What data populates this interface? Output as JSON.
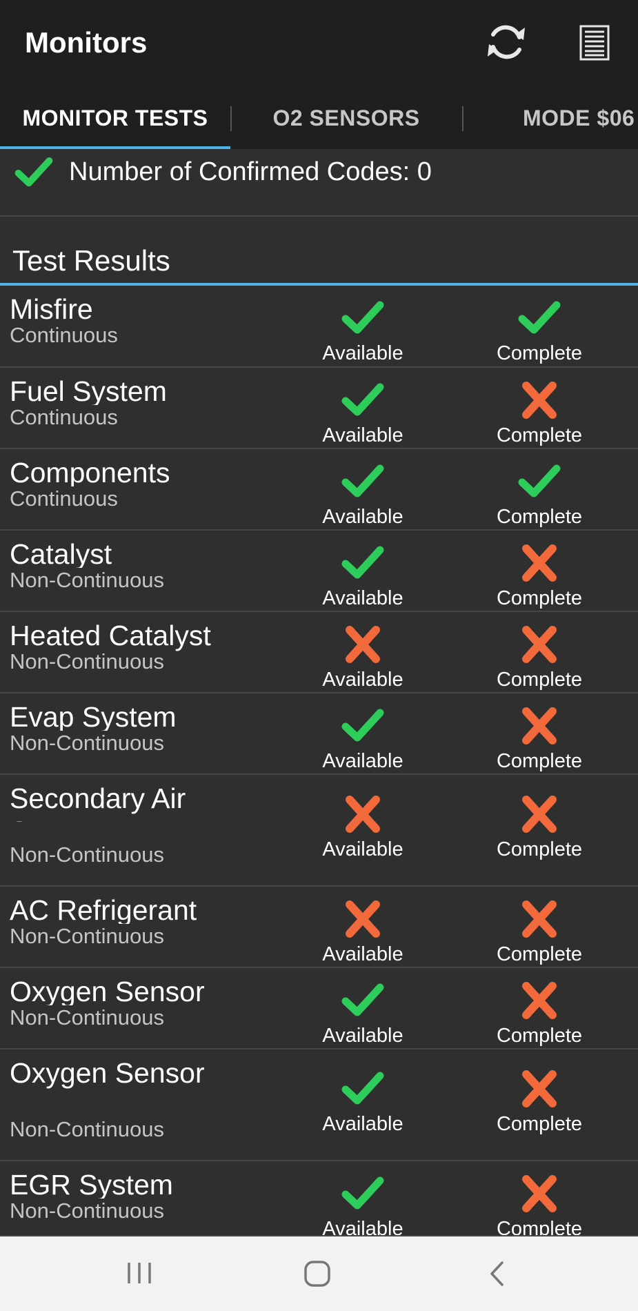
{
  "app_bar": {
    "title": "Monitors",
    "actions": [
      "refresh-icon",
      "document-list-icon"
    ]
  },
  "tabs": [
    {
      "label": "MONITOR TESTS",
      "selected": true
    },
    {
      "label": "O2 SENSORS",
      "selected": false
    },
    {
      "label": "MODE $06",
      "selected": false
    }
  ],
  "confirmed_codes": {
    "text": "Number of Confirmed Codes: 0",
    "icon": "check-icon"
  },
  "section_title": "Test Results",
  "labels": {
    "available": "Available",
    "complete": "Complete"
  },
  "monitors": [
    {
      "name": "Misfire",
      "type": "Continuous",
      "available": true,
      "complete": true
    },
    {
      "name": "Fuel System",
      "type": "Continuous",
      "available": true,
      "complete": false
    },
    {
      "name": "Components",
      "type": "Continuous",
      "available": true,
      "complete": true
    },
    {
      "name": "Catalyst",
      "type": "Non-Continuous",
      "available": true,
      "complete": false
    },
    {
      "name": "Heated Catalyst",
      "type": "Non-Continuous",
      "available": false,
      "complete": false
    },
    {
      "name": "Evap System",
      "type": "Non-Continuous",
      "available": true,
      "complete": false
    },
    {
      "name": "Secondary Air System",
      "type": "Non-Continuous",
      "available": false,
      "complete": false
    },
    {
      "name": "AC Refrigerant",
      "type": "Non-Continuous",
      "available": false,
      "complete": false
    },
    {
      "name": "Oxygen Sensor",
      "type": "Non-Continuous",
      "available": true,
      "complete": false
    },
    {
      "name": "Oxygen Sensor Heater",
      "type": "Non-Continuous",
      "available": true,
      "complete": false
    },
    {
      "name": "EGR System",
      "type": "Non-Continuous",
      "available": true,
      "complete": false
    }
  ],
  "colors": {
    "check": "#2ecc5a",
    "cross": "#f26a3c",
    "accent": "#4fb3e8"
  },
  "nav_bar": [
    "recent-apps-icon",
    "home-icon",
    "back-icon"
  ]
}
